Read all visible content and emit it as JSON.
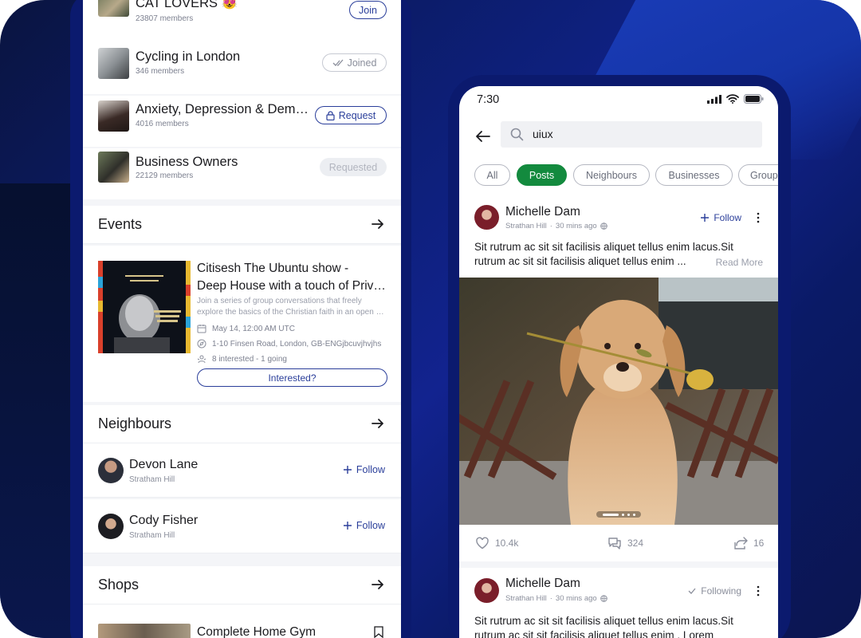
{
  "left_screen": {
    "groups": [
      {
        "name": "CAT LOVERS 😻",
        "members": "23807 members",
        "action": "Join",
        "state": "join"
      },
      {
        "name": "Cycling in London",
        "members": "346 members",
        "action": "Joined",
        "state": "joined"
      },
      {
        "name": "Anxiety, Depression & Dementia",
        "members": "4016 members",
        "action": "Request",
        "state": "request"
      },
      {
        "name": "Business Owners",
        "members": "22129 members",
        "action": "Requested",
        "state": "requested"
      }
    ],
    "events": {
      "section_title": "Events",
      "title_line1": "Citisesh The Ubuntu show -",
      "title_line2": "Deep House with a touch of Private",
      "desc_line1": "Join a series of group conversations that freely",
      "desc_line2": "explore the basics of the Christian faith in an open and",
      "date": "May 14, 12:00 AM UTC",
      "address": "1-10 Finsen Road, London, GB-ENGjbcuvjhvjhs",
      "interest": "8 interested - 1 going",
      "button": "Interested?"
    },
    "neighbours": {
      "section_title": "Neighbours",
      "items": [
        {
          "name": "Devon Lane",
          "location": "Stratham Hill",
          "action": "Follow"
        },
        {
          "name": "Cody Fisher",
          "location": "Stratham Hill",
          "action": "Follow"
        }
      ]
    },
    "shops": {
      "section_title": "Shops",
      "first_item": "Complete Home Gym"
    }
  },
  "right_screen": {
    "status_time": "7:30",
    "search_query": "uiux",
    "filters": [
      "All",
      "Posts",
      "Neighbours",
      "Businesses",
      "Groups"
    ],
    "active_filter": "Posts",
    "posts": [
      {
        "author": "Michelle Dam",
        "location": "Strathan Hill",
        "time": "30 mins ago",
        "follow_label": "Follow",
        "text_line1": "Sit rutrum ac sit sit facilisis aliquet tellus enim lacus.Sit",
        "text_line2": "rutrum ac sit sit facilisis aliquet tellus enim ...",
        "read_more": "Read More",
        "likes": "10.4k",
        "comments": "324",
        "shares": "16"
      },
      {
        "author": "Michelle Dam",
        "location": "Strathan Hill",
        "time": "30 mins ago",
        "follow_label": "Following",
        "text_line1": "Sit rutrum ac sit sit facilisis aliquet tellus enim lacus.Sit",
        "text_line2": "rutrum ac sit sit facilisis aliquet tellus enim . Lorem"
      }
    ]
  },
  "colors": {
    "brand_blue": "#2a3e9a",
    "active_chip": "#138a3e",
    "background_navy": "#0d1f78"
  }
}
